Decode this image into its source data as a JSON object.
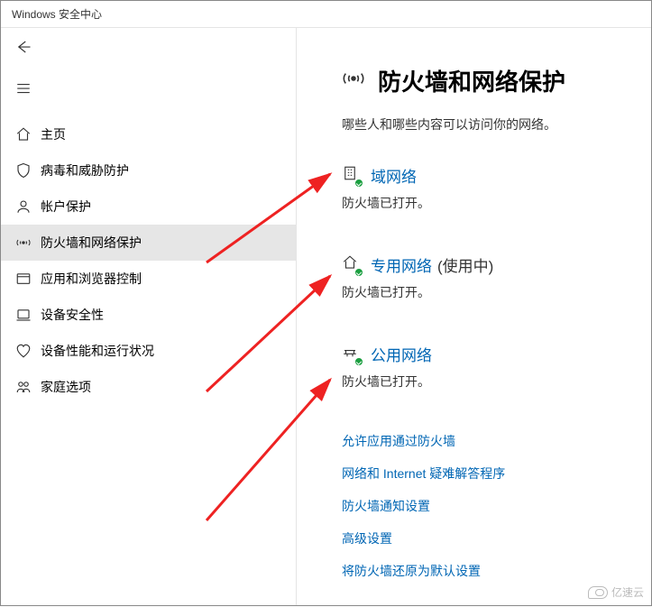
{
  "window": {
    "title": "Windows 安全中心"
  },
  "sidebar": {
    "items": [
      {
        "label": "主页"
      },
      {
        "label": "病毒和威胁防护"
      },
      {
        "label": "帐户保护"
      },
      {
        "label": "防火墙和网络保护"
      },
      {
        "label": "应用和浏览器控制"
      },
      {
        "label": "设备安全性"
      },
      {
        "label": "设备性能和运行状况"
      },
      {
        "label": "家庭选项"
      }
    ]
  },
  "page": {
    "title": "防火墙和网络保护",
    "description": "哪些人和哪些内容可以访问你的网络。"
  },
  "networks": [
    {
      "title": "域网络",
      "suffix": "",
      "status": "防火墙已打开。"
    },
    {
      "title": "专用网络",
      "suffix": "(使用中)",
      "status": "防火墙已打开。"
    },
    {
      "title": "公用网络",
      "suffix": "",
      "status": "防火墙已打开。"
    }
  ],
  "links": [
    {
      "label": "允许应用通过防火墙"
    },
    {
      "label": "网络和 Internet 疑难解答程序"
    },
    {
      "label": "防火墙通知设置"
    },
    {
      "label": "高级设置"
    },
    {
      "label": "将防火墙还原为默认设置"
    }
  ],
  "watermark": {
    "text": "亿速云"
  }
}
